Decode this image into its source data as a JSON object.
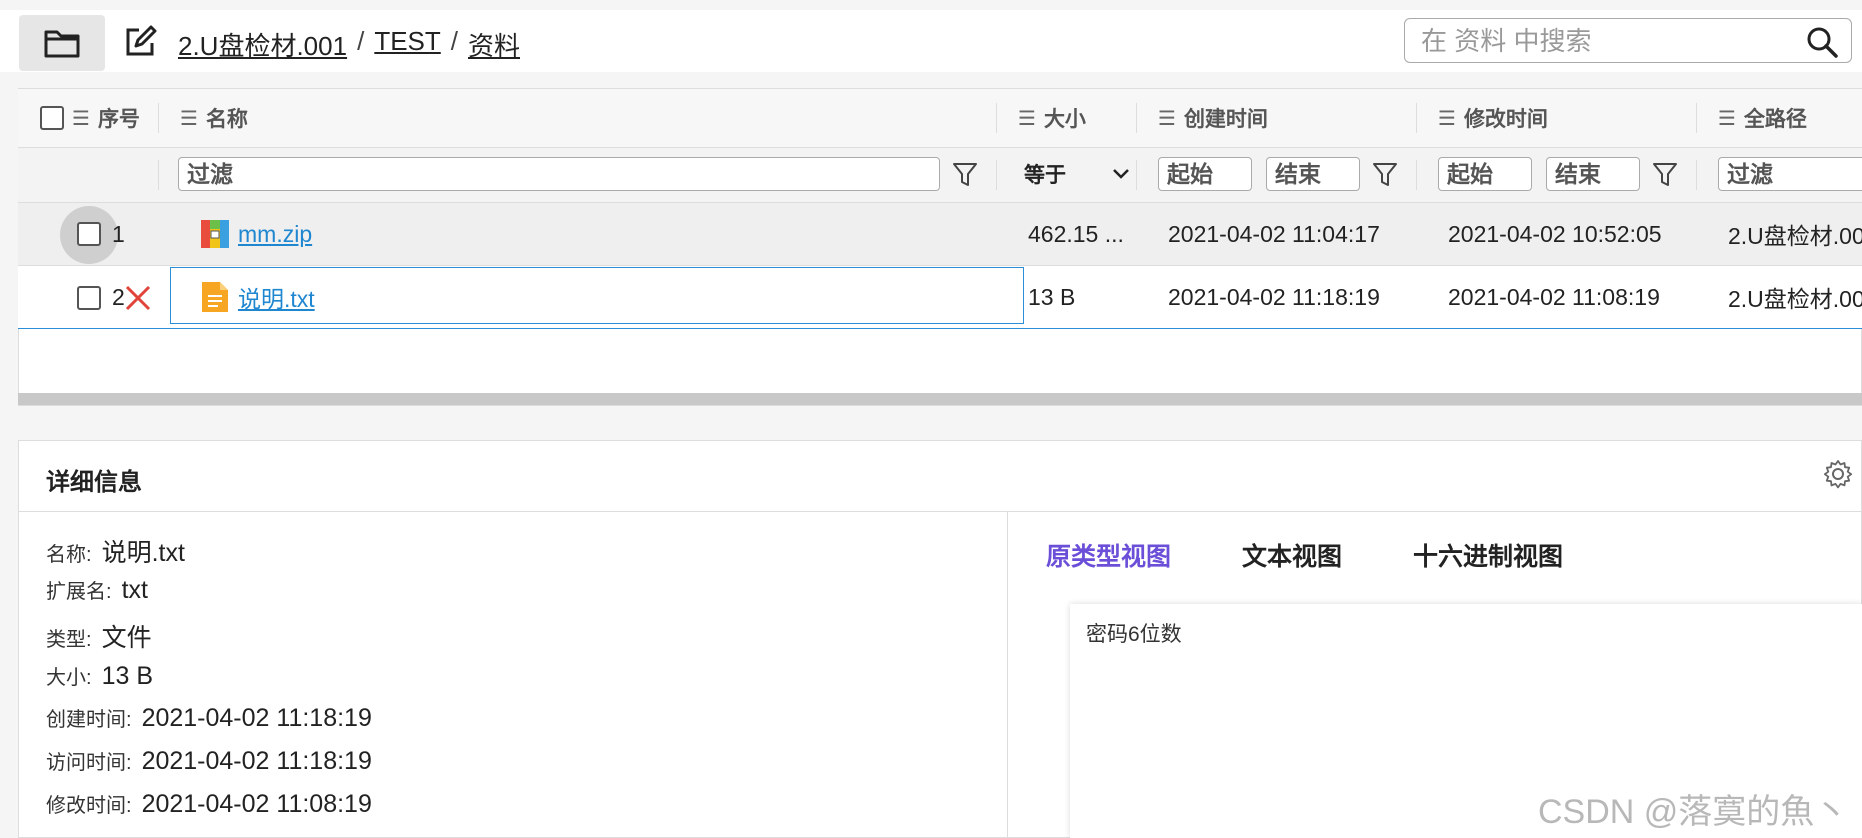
{
  "toolbar": {
    "breadcrumb": [
      "2.U盘检材.001",
      "TEST",
      "资料"
    ],
    "separator": "/",
    "search_placeholder": "在 资料 中搜索"
  },
  "grid": {
    "columns": {
      "index": "序号",
      "name": "名称",
      "size": "大小",
      "created": "创建时间",
      "modified": "修改时间",
      "path": "全路径"
    },
    "filters": {
      "name": "过滤",
      "size_op": "等于",
      "created_start": "起始",
      "created_end": "结束",
      "modified_start": "起始",
      "modified_end": "结束",
      "path": "过滤"
    },
    "rows": [
      {
        "index": "1",
        "name": "mm.zip",
        "size": "462.15 ...",
        "created": "2021-04-02 11:04:17",
        "modified": "2021-04-02 10:52:05",
        "path": "2.U盘检材.00",
        "icon": "zip-archive-icon"
      },
      {
        "index": "2",
        "name": "说明.txt",
        "size": "13 B",
        "created": "2021-04-02 11:18:19",
        "modified": "2021-04-02 11:08:19",
        "path": "2.U盘检材.00",
        "icon": "text-file-icon",
        "deleted": true
      }
    ]
  },
  "details": {
    "title": "详细信息",
    "fields": [
      {
        "key": "名称:",
        "value": "说明.txt"
      },
      {
        "key": "扩展名:",
        "value": "txt"
      },
      {
        "key": "类型:",
        "value": "文件"
      },
      {
        "key": "大小:",
        "value": "13 B"
      },
      {
        "key": "创建时间:",
        "value": "2021-04-02 11:18:19"
      },
      {
        "key": "访问时间:",
        "value": "2021-04-02 11:18:19"
      },
      {
        "key": "修改时间:",
        "value": "2021-04-02 11:08:19"
      }
    ],
    "tabs": [
      "原类型视图",
      "文本视图",
      "十六进制视图"
    ],
    "active_tab_color": "#6b4fd8",
    "preview_text": "密码6位数"
  },
  "watermark": "CSDN @落寞的魚丶",
  "colors": {
    "link": "#1f86d0",
    "deleted": "#e0443a",
    "selection_border": "#2b8fd8"
  }
}
